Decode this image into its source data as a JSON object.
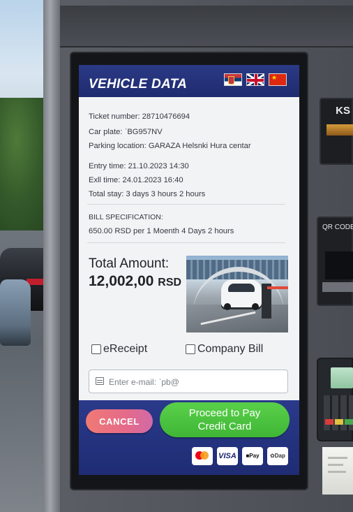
{
  "header": {
    "title": "VEHICLE DATA"
  },
  "languages": [
    {
      "code": "sr",
      "icon": "serbia-flag-icon"
    },
    {
      "code": "en",
      "icon": "uk-flag-icon"
    },
    {
      "code": "zh",
      "icon": "china-flag-icon"
    }
  ],
  "ticket": {
    "ticket_number": "Ticket number: 28710476694",
    "car_plate": "Car plate: ˈBG957NV",
    "parking_location": "Parking location: GARAZA Helsnki Hura centar",
    "entry_time": "Entry time: 21.10.2023 14:30",
    "exit_time": "Exll time: 24.01.2023 16:40",
    "total_stay": "Total stay: 3 days 3 hours 2 hours"
  },
  "bill": {
    "heading": "BILL SPECIFICATION:",
    "line": "650.00 RSD per 1 Moenth 4 Days 2 hours"
  },
  "total": {
    "label": "Total Amount:",
    "amount": "12,002,00",
    "currency": "RSD"
  },
  "options": {
    "ereceipt_label": "eReceipt",
    "company_bill_label": "Company Bill"
  },
  "email": {
    "placeholder": "Enter e-mail: ˈpb@"
  },
  "actions": {
    "cancel_label": "CANCEL",
    "pay_line1": "Proceed to Pay",
    "pay_line2": "Credit Card"
  },
  "payment_methods": [
    {
      "icon": "mastercard-icon"
    },
    {
      "label": "VISA",
      "icon": "visa-icon"
    },
    {
      "label": "Pay",
      "icon": "apple-pay-icon"
    },
    {
      "label": "Dap",
      "icon": "dinapay-icon"
    }
  ],
  "kiosk": {
    "slot_top_label": "KS",
    "slot_qr_label": "QR CODE"
  },
  "colors": {
    "header_blue": "#2b3a86",
    "pay_green": "#4cc43f",
    "cancel_pink": "#e56a8a"
  }
}
